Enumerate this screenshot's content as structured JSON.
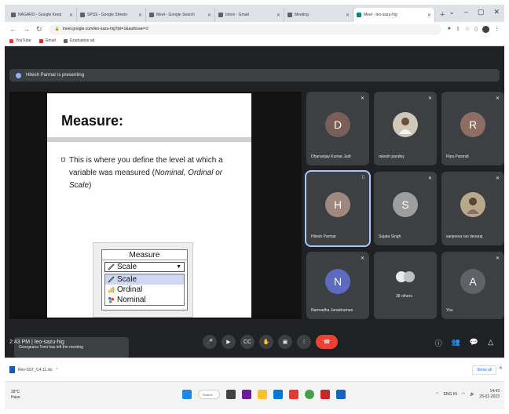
{
  "browser": {
    "tabs": [
      {
        "title": "NAGARO - Google Keep"
      },
      {
        "title": "SPSS - Google Sheets"
      },
      {
        "title": "Meet - Google Search"
      },
      {
        "title": "Inbox - Gmail"
      },
      {
        "title": "Meeting"
      },
      {
        "title": "Meet - leo-sazu-hig",
        "active": true
      }
    ],
    "url": "meet.google.com/leo-sazu-hig?pli=1&authuser=2",
    "bookmarks": [
      "YouTube",
      "Gmail",
      "Graduation ad"
    ],
    "window_controls": [
      "⌄",
      "–",
      "▢",
      "✕"
    ]
  },
  "meet": {
    "presenting_text": "Hitesh Parmar is presenting",
    "toast": "Georgeana Tomi has left the meeting",
    "clock": "2:43 PM",
    "meeting_code": "leo-sazu-hig",
    "clock_line": "2:43 PM  |  leo-sazu-hig",
    "slide": {
      "title": "Measure:",
      "bullet_prefix": "This is where you define the level at which a variable was measured (",
      "bullet_italic": "Nominal, Ordinal or Scale",
      "bullet_suffix": ")",
      "spss": {
        "header": "Measure",
        "selected": "Scale",
        "options": [
          "Scale",
          "Ordinal",
          "Nominal"
        ]
      }
    },
    "participants": [
      {
        "name": "Dhananjay Kumar Jadi",
        "initial": "D",
        "color": "#7b5e57"
      },
      {
        "name": "rakesh pandey",
        "initial": "",
        "photo": true
      },
      {
        "name": "Riya Parandi",
        "initial": "R",
        "color": "#8d6e63"
      },
      {
        "name": "Hitesh Parmar",
        "initial": "H",
        "color": "#a1887f",
        "speaking": true
      },
      {
        "name": "Sujata Singh",
        "initial": "S",
        "color": "#9e9e9e"
      },
      {
        "name": "sanjeeva rao devaraj",
        "initial": "",
        "photo": true
      },
      {
        "name": "Narmadha Janakiraman",
        "initial": "N",
        "color": "#5c6bc0"
      },
      {
        "name": "38 others",
        "initial": "88",
        "color": "#3c4043"
      },
      {
        "name": "You",
        "initial": "A",
        "color": "#5f6368"
      }
    ],
    "controls": [
      "mic",
      "camera",
      "captions",
      "raise hand",
      "present",
      "more",
      "leave"
    ],
    "right_controls": [
      "info",
      "people",
      "chat",
      "activities"
    ],
    "participant_count": "47"
  },
  "downloads": {
    "file": "Rev-SST_C4.11.xls",
    "show_all": "Show all"
  },
  "taskbar": {
    "weather_temp": "28°C",
    "weather_desc": "Haze",
    "search_label": "Search",
    "time": "14:43",
    "date": "25-01-2023",
    "lang": "ENG IN"
  },
  "colors": {
    "meet_bg": "#202124",
    "tile_bg": "#3c4043",
    "end_call": "#ea4335",
    "speaking_outline": "#a8c7fa"
  }
}
